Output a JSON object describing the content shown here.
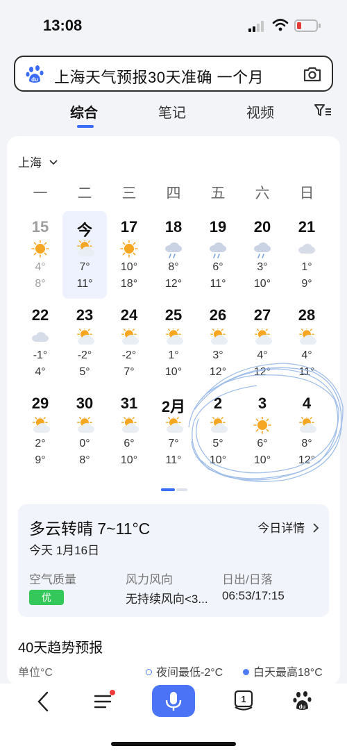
{
  "status_bar": {
    "time": "13:08"
  },
  "search": {
    "query": "上海天气预报30天准确 一个月"
  },
  "tabs": [
    {
      "label": "综合",
      "active": true
    },
    {
      "label": "笔记",
      "active": false
    },
    {
      "label": "视频",
      "active": false
    }
  ],
  "calendar": {
    "city": "上海",
    "weekdays": [
      "一",
      "二",
      "三",
      "四",
      "五",
      "六",
      "日"
    ],
    "days": [
      {
        "label": "15",
        "icon": "sun-icon",
        "hi": "4°",
        "lo": "8°",
        "state": "past"
      },
      {
        "label": "今",
        "icon": "partly-cloudy-icon",
        "hi": "7°",
        "lo": "11°",
        "state": "today"
      },
      {
        "label": "17",
        "icon": "sun-icon",
        "hi": "10°",
        "lo": "18°",
        "state": "future"
      },
      {
        "label": "18",
        "icon": "rain-icon",
        "hi": "8°",
        "lo": "12°",
        "state": "future"
      },
      {
        "label": "19",
        "icon": "rain-icon",
        "hi": "6°",
        "lo": "11°",
        "state": "future"
      },
      {
        "label": "20",
        "icon": "rain-icon",
        "hi": "3°",
        "lo": "10°",
        "state": "future"
      },
      {
        "label": "21",
        "icon": "cloud-icon",
        "hi": "1°",
        "lo": "9°",
        "state": "future"
      },
      {
        "label": "22",
        "icon": "cloud-icon",
        "hi": "-1°",
        "lo": "4°",
        "state": "future"
      },
      {
        "label": "23",
        "icon": "partly-cloudy-icon",
        "hi": "-2°",
        "lo": "5°",
        "state": "future"
      },
      {
        "label": "24",
        "icon": "partly-cloudy-icon",
        "hi": "-2°",
        "lo": "7°",
        "state": "future"
      },
      {
        "label": "25",
        "icon": "partly-cloudy-icon",
        "hi": "1°",
        "lo": "10°",
        "state": "future"
      },
      {
        "label": "26",
        "icon": "partly-cloudy-icon",
        "hi": "3°",
        "lo": "12°",
        "state": "future"
      },
      {
        "label": "27",
        "icon": "partly-cloudy-icon",
        "hi": "4°",
        "lo": "12°",
        "state": "future"
      },
      {
        "label": "28",
        "icon": "partly-cloudy-icon",
        "hi": "4°",
        "lo": "11°",
        "state": "future"
      },
      {
        "label": "29",
        "icon": "partly-cloudy-icon",
        "hi": "2°",
        "lo": "9°",
        "state": "future"
      },
      {
        "label": "30",
        "icon": "partly-cloudy-icon",
        "hi": "0°",
        "lo": "8°",
        "state": "future"
      },
      {
        "label": "31",
        "icon": "partly-cloudy-icon",
        "hi": "6°",
        "lo": "10°",
        "state": "future"
      },
      {
        "label": "2月",
        "icon": "partly-cloudy-icon",
        "hi": "7°",
        "lo": "11°",
        "state": "future"
      },
      {
        "label": "2",
        "icon": "partly-cloudy-icon",
        "hi": "5°",
        "lo": "10°",
        "state": "future"
      },
      {
        "label": "3",
        "icon": "sun-icon",
        "hi": "6°",
        "lo": "10°",
        "state": "future"
      },
      {
        "label": "4",
        "icon": "partly-cloudy-icon",
        "hi": "8°",
        "lo": "12°",
        "state": "future"
      }
    ]
  },
  "summary": {
    "title": "多云转晴 7~11°C",
    "detail_link": "今日详情",
    "date": "今天 1月16日",
    "air_quality_label": "空气质量",
    "air_quality_value": "优",
    "wind_label": "风力风向",
    "wind_value": "无持续风向<3...",
    "sun_label": "日出/日落",
    "sun_value": "06:53/17:15"
  },
  "trend": {
    "title": "40天趋势预报",
    "unit": "单位°C",
    "night_low": "夜间最低-2°C",
    "day_high": "白天最高18°C"
  },
  "colors": {
    "accent": "#3b6cf6",
    "mic_button": "#4a74f5",
    "air_good": "#34c759",
    "today_bg": "#eef2ff",
    "sun": "#f5a623",
    "cloud": "#d7dde8"
  }
}
